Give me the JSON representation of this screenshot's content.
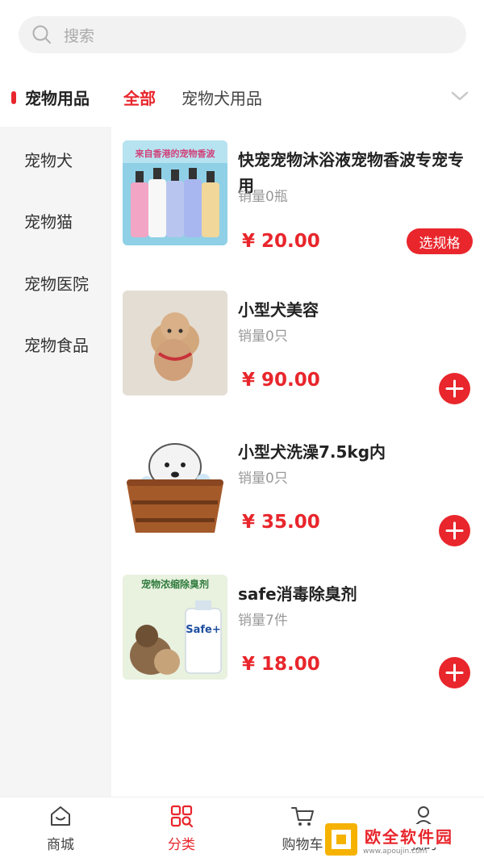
{
  "search": {
    "placeholder": "搜索"
  },
  "category_bar": {
    "main_category": "宠物用品",
    "tabs": [
      {
        "label": "全部",
        "active": true
      },
      {
        "label": "宠物犬用品",
        "active": false
      }
    ]
  },
  "sidebar": {
    "items": [
      "宠物犬",
      "宠物猫",
      "宠物医院",
      "宠物食品"
    ]
  },
  "products": [
    {
      "title": "快宠宠物沐浴液宠物香波专宠专用",
      "sales": "销量0瓶",
      "price": "¥ 20.00",
      "action": "选规格",
      "image_text": "来自香港的宠物香波"
    },
    {
      "title": "小型犬美容",
      "sales": "销量0只",
      "price": "¥ 90.00",
      "action": "add"
    },
    {
      "title": "小型犬洗澡7.5kg内",
      "sales": "销量0只",
      "price": "¥ 35.00",
      "action": "add"
    },
    {
      "title": "safe消毒除臭剂",
      "sales": "销量7件",
      "price": "¥ 18.00",
      "action": "add",
      "image_text": "宠物浓缩除臭剂",
      "image_brand": "Safe+"
    }
  ],
  "tabbar": {
    "items": [
      {
        "label": "商城",
        "icon": "home-icon",
        "active": false
      },
      {
        "label": "分类",
        "icon": "category-icon",
        "active": true
      },
      {
        "label": "购物车",
        "icon": "cart-icon",
        "active": false
      },
      {
        "label": "我的",
        "icon": "user-icon",
        "active": false
      }
    ]
  },
  "watermark": {
    "text": "欧全软件园",
    "url": "www.apoujin.com"
  },
  "colors": {
    "accent": "#e8262c",
    "sidebar_bg": "#f5f5f5"
  }
}
